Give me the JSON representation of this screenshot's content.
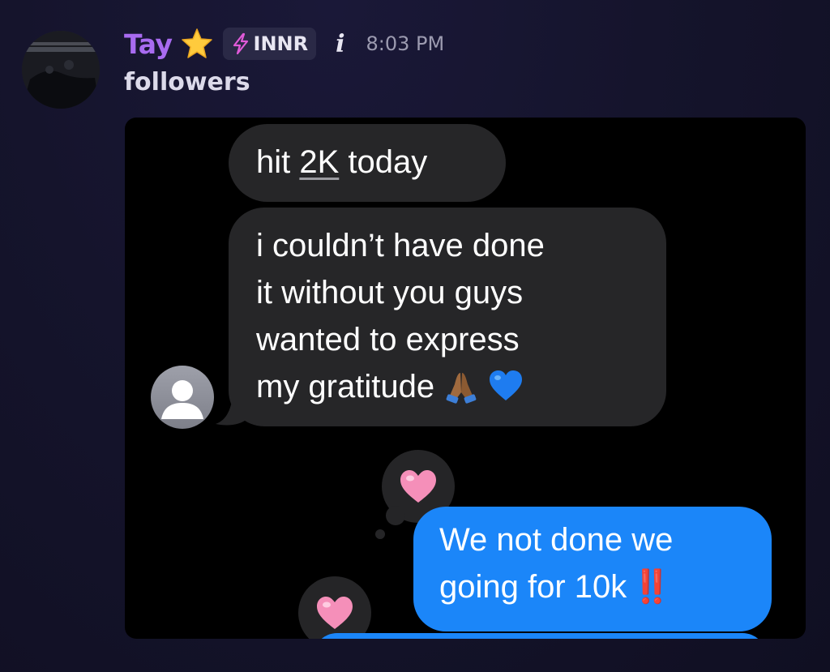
{
  "message": {
    "author": {
      "name": "Tay",
      "badge_icon": "star-icon",
      "tag_icon": "lightning-bolt-icon",
      "tag_label": "INNR",
      "name_color": "#a86bf0"
    },
    "info_icon": "i",
    "timestamp": "8:03 PM",
    "text": "followers"
  },
  "screenshot": {
    "messages": [
      {
        "direction": "incoming",
        "parts": [
          "hit ",
          "2K",
          " today"
        ]
      },
      {
        "direction": "incoming",
        "lines": [
          "i couldn’t have done",
          "it without you guys",
          "wanted to express",
          "my gratitude"
        ],
        "emojis": [
          "folded-hands-emoji",
          "blue-heart-emoji"
        ]
      },
      {
        "direction": "outgoing",
        "lines": [
          "We not done we",
          "going for 10k"
        ],
        "trailing": "‼️",
        "reactions": [
          "pink-heart-reaction"
        ]
      }
    ],
    "next_message_reaction": "pink-heart-reaction",
    "colors": {
      "incoming_bubble": "#262628",
      "outgoing_bubble": "#1b86f9",
      "background": "#000000"
    }
  }
}
